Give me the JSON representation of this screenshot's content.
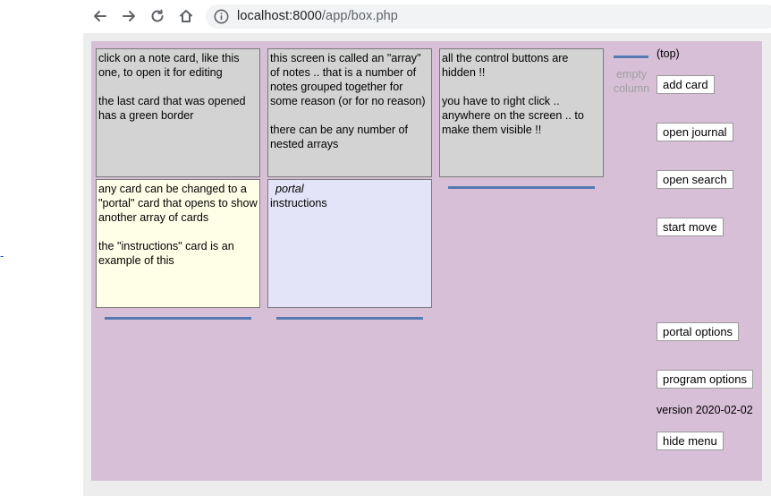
{
  "browser": {
    "url_host": "localhost:8000",
    "url_path": "/app/box.php"
  },
  "page": {
    "stray_text": "-",
    "cards": [
      {
        "text": "click on a note card, like this one, to open it for editing\n\nthe last card that was opened has a green border"
      },
      {
        "text": "this screen is called an \"array\" of notes .. that is a number of notes grouped together for some reason (or for no reason)\n\nthere can be any number of nested arrays"
      },
      {
        "text": "all the control buttons are hidden !!\n\nyou have to right click .. anywhere on the screen .. to make them visible !!"
      },
      {
        "text": "any card can be changed to a \"portal\" card that opens to show another array of cards\n\nthe \"instructions\" card is an example of this"
      },
      {
        "portal_tag": "portal",
        "text": "instructions"
      }
    ],
    "empty_column": "empty column",
    "top_label": "(top)",
    "buttons": {
      "add_card": "add card",
      "open_journal": "open journal",
      "open_search": "open search",
      "start_move": "start move",
      "portal_options": "portal options",
      "program_options": "program options",
      "hide_menu": "hide menu"
    },
    "version": "version 2020-02-02"
  },
  "colors": {
    "array_bg": "#d8bfd8",
    "card_gray": "#d3d3d3",
    "card_yellow": "#ffffe8",
    "card_lavender": "#e4e4f8",
    "insert_bar": "#5579b0"
  }
}
